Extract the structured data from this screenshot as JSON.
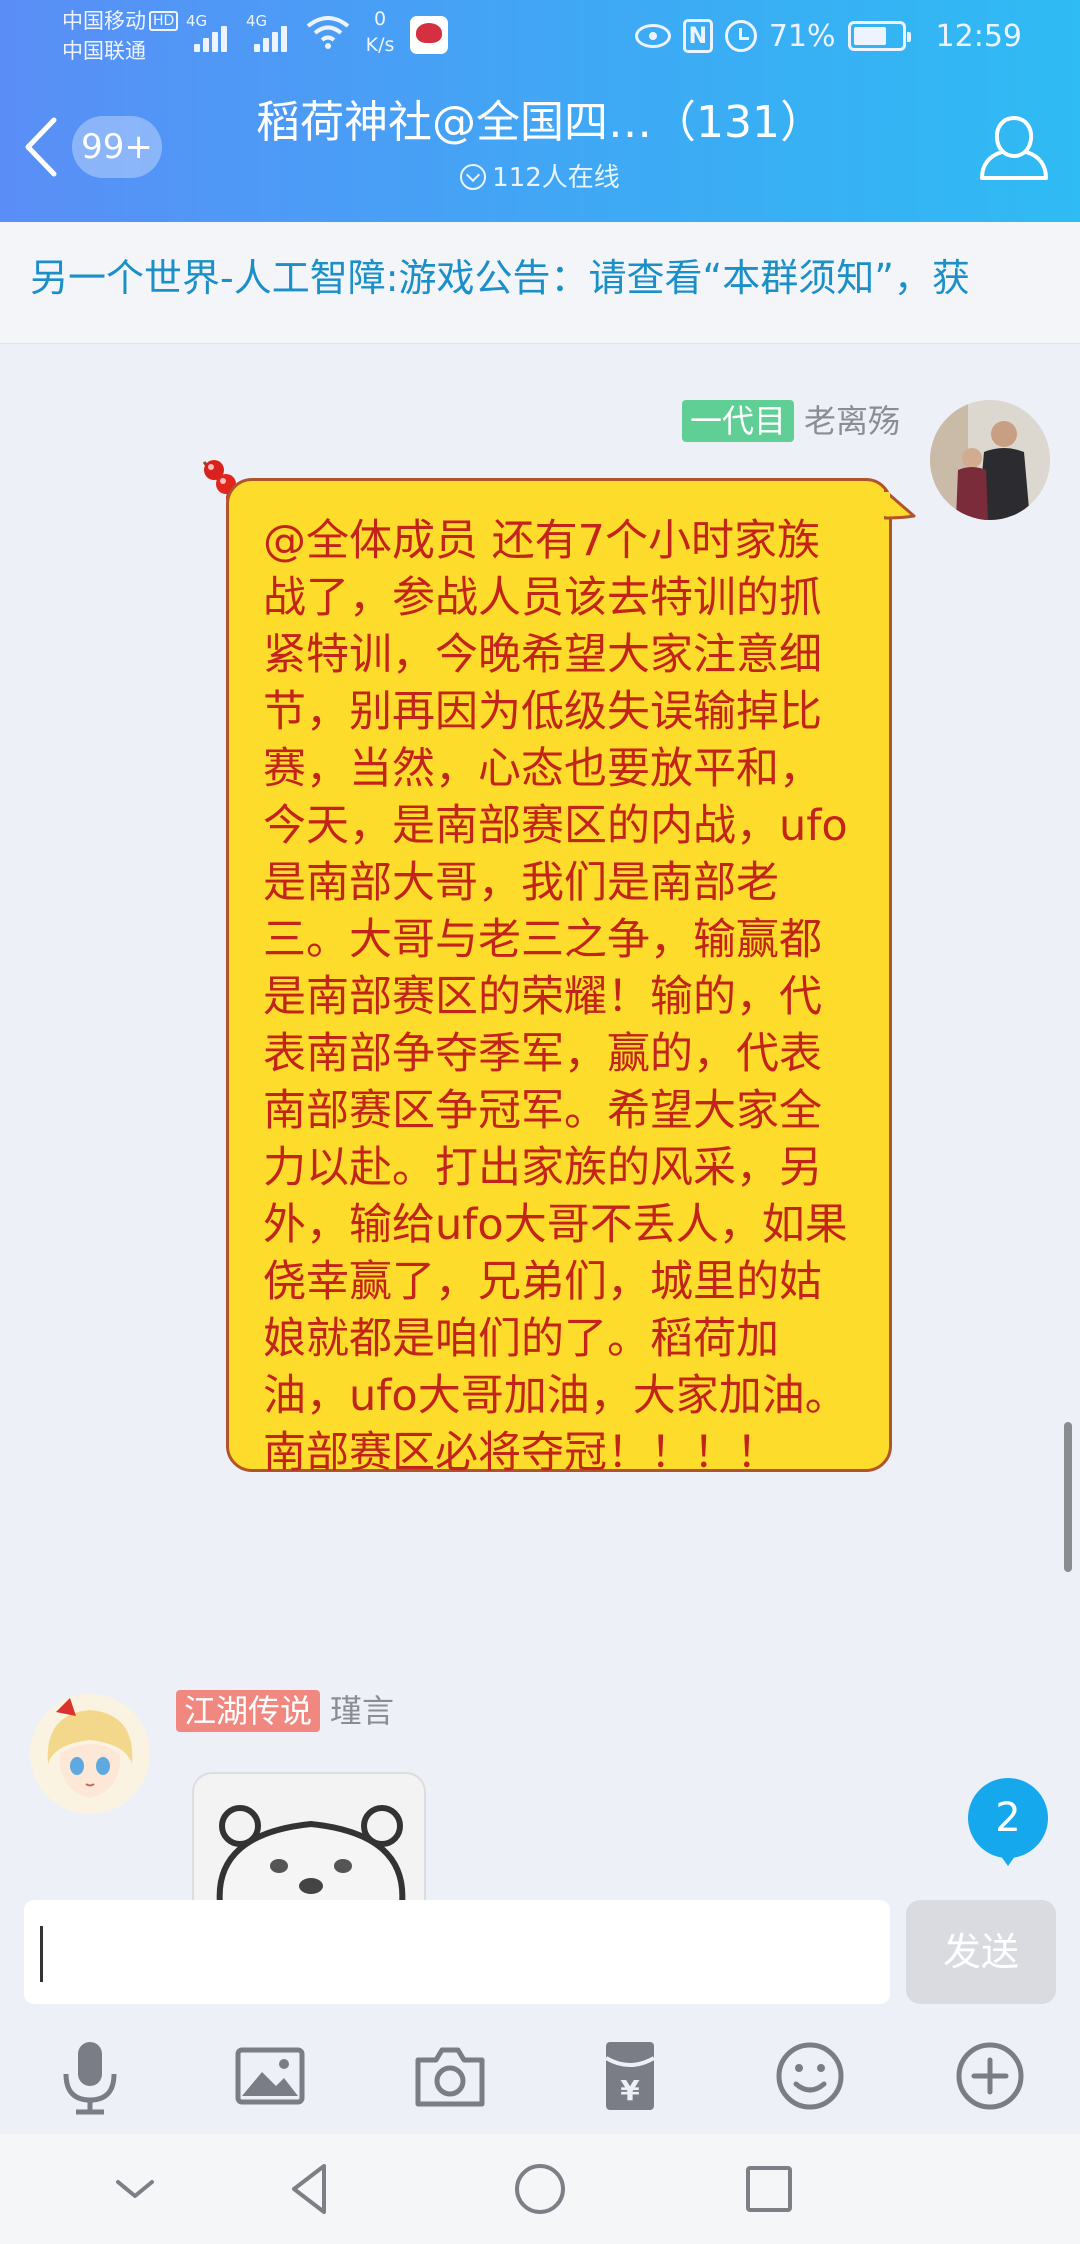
{
  "status_bar": {
    "carrier_1": "中国移动",
    "carrier_1_badge": "HD",
    "carrier_2": "中国联通",
    "signal_1_label": "4G",
    "signal_2_label": "4G",
    "net_speed_value": "0",
    "net_speed_unit": "K/s",
    "battery_percent": "71%",
    "battery_level": 0.71,
    "time": "12:59"
  },
  "header": {
    "back_unread_count": "99+",
    "chat_title": "稻荷神社@全国四…（131）",
    "online_count": "112人在线"
  },
  "announcement": {
    "text": "另一个世界-人工智障:游戏公告：请查看“本群须知”，获"
  },
  "messages": [
    {
      "side": "right",
      "rank": "一代目",
      "rank_color": "#5fcf95",
      "sender": "老离殇",
      "text": "@全体成员 还有7个小时家族战了，参战人员该去特训的抓紧特训，今晚希望大家注意细节，别再因为低级失误输掉比赛，当然，心态也要放平和，今天，是南部赛区的内战，ufo是南部大哥，我们是南部老三。大哥与老三之争，输赢都是南部赛区的荣耀！输的，代表南部争夺季军，赢的，代表南部赛区争冠军。希望大家全力以赴。打出家族的风采，另外，输给ufo大哥不丢人，如果侥幸赢了，兄弟们，城里的姑娘就都是咱们的了。稻荷加油，ufo大哥加油，大家加油。南部赛区必将夺冠！！！！"
    },
    {
      "side": "left",
      "rank": "江湖传说",
      "rank_color": "#f08880",
      "sender": "瑾言",
      "content_type": "image"
    }
  ],
  "new_message_badge": "2",
  "input": {
    "value": "",
    "send_label": "发送"
  },
  "toolbar_icons": [
    "microphone-icon",
    "image-icon",
    "camera-icon",
    "red-packet-icon",
    "emoji-icon",
    "plus-icon"
  ],
  "colors": {
    "header_start": "#5a8ef6",
    "header_end": "#2fbbf3",
    "bubble_fill": "#fddc2c",
    "bubble_text": "#c3241a",
    "announcement_text": "#1b8fc8",
    "badge": "#16a8ec"
  }
}
